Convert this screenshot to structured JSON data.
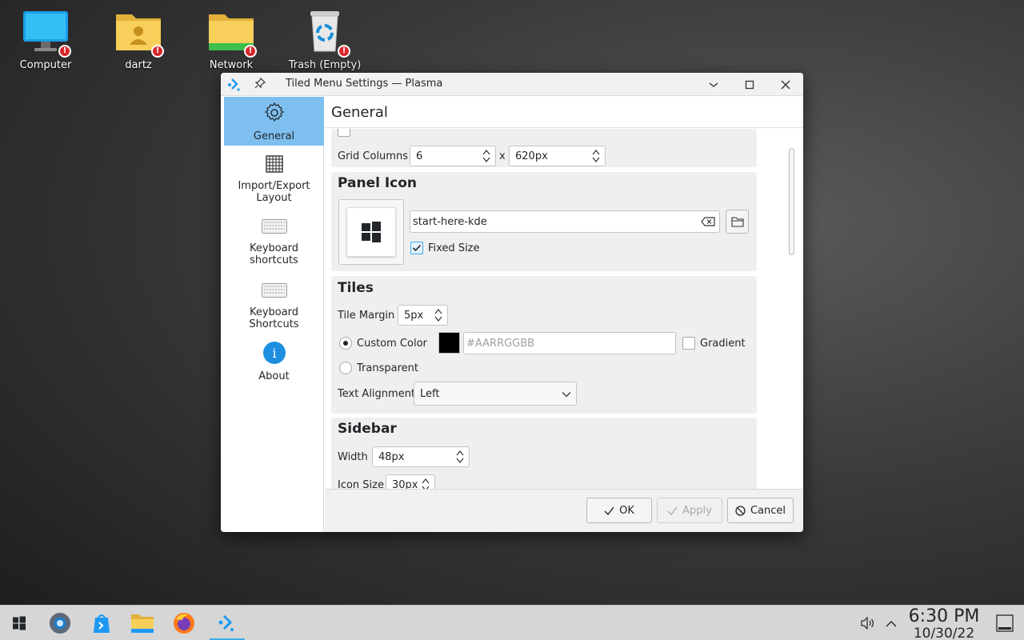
{
  "desktop": {
    "icons": [
      {
        "label": "Computer"
      },
      {
        "label": "dartz"
      },
      {
        "label": "Network"
      },
      {
        "label": "Trash (Empty)"
      }
    ],
    "badge_glyph": "!"
  },
  "window": {
    "title": "Tiled Menu Settings — Plasma",
    "pin_icon": "pin-icon",
    "minimize_glyph": "—",
    "maximize_glyph": "□",
    "close_glyph": "✕"
  },
  "sidebar": {
    "items": [
      {
        "label": "General",
        "icon": "gear-icon",
        "active": true
      },
      {
        "label": "Import/Export Layout",
        "label_line1": "Import/Export",
        "label_line2": "Layout",
        "icon": "grid-icon"
      },
      {
        "label": "Keyboard shortcuts",
        "label_line1": "Keyboard",
        "label_line2": "shortcuts",
        "icon": "keyboard-icon"
      },
      {
        "label": "Keyboard Shortcuts",
        "label_line1": "Keyboard",
        "label_line2": "Shortcuts",
        "icon": "keyboard-icon"
      },
      {
        "label": "About",
        "icon": "info-icon",
        "glyph": "i"
      }
    ]
  },
  "main": {
    "header": "General",
    "grid": {
      "label": "Grid Columns",
      "columns_value": "6",
      "times": "x",
      "width_value": "620px"
    },
    "panel_icon": {
      "title": "Panel Icon",
      "icon_name": "start-here-kde",
      "fixed_size_label": "Fixed Size",
      "fixed_size_checked": true
    },
    "tiles": {
      "title": "Tiles",
      "margin_label": "Tile Margin",
      "margin_value": "5px",
      "custom_color_label": "Custom Color",
      "custom_color_selected": true,
      "color_swatch": "#000000",
      "color_placeholder": "#AARRGGBB",
      "gradient_label": "Gradient",
      "gradient_checked": false,
      "transparent_label": "Transparent",
      "text_alignment_label": "Text Alignment",
      "text_alignment_value": "Left"
    },
    "sidebar_section": {
      "title": "Sidebar",
      "width_label": "Width",
      "width_value": "48px",
      "icon_size_label": "Icon Size",
      "icon_size_value": "30px"
    }
  },
  "footer": {
    "ok_label": "OK",
    "apply_label": "Apply",
    "cancel_label": "Cancel"
  },
  "taskbar": {
    "apps": [
      "start-menu-icon",
      "settings-icon",
      "discover-icon",
      "file-manager-icon",
      "firefox-icon",
      "plasma-settings-icon"
    ],
    "time": "6:30 PM",
    "date": "10/30/22"
  },
  "colors": {
    "accent": "#3daee9",
    "sidebar_active": "#7ebff0",
    "badge": "#d9262b"
  }
}
